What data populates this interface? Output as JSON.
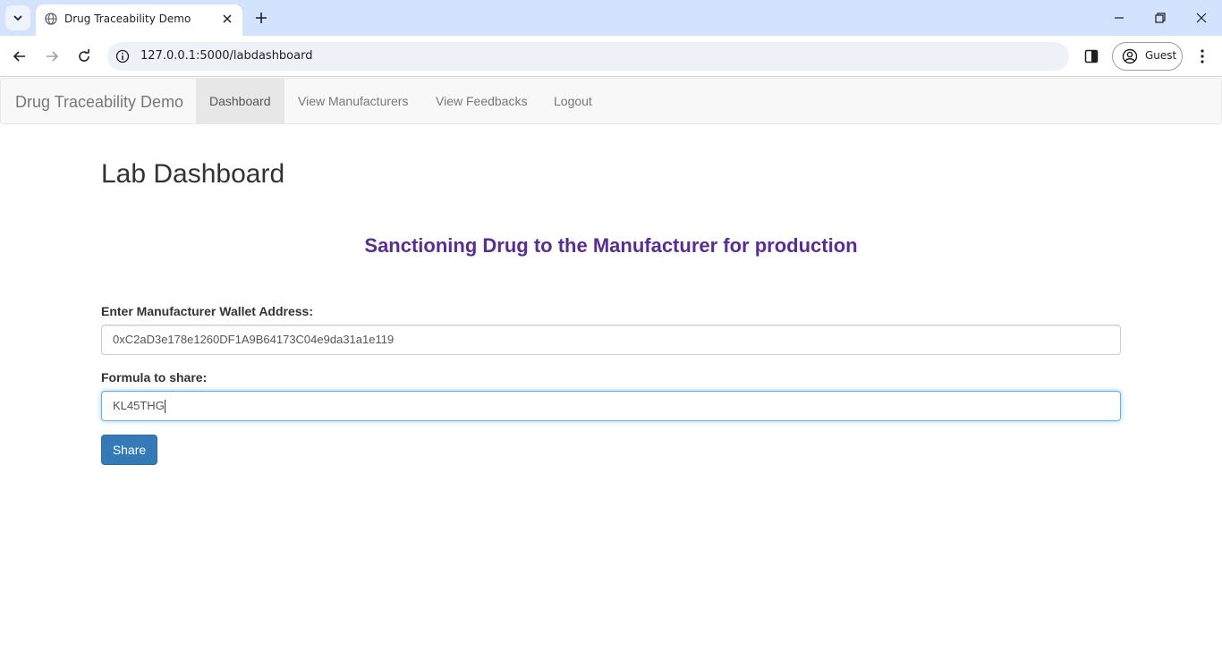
{
  "browser": {
    "tab_title": "Drug Traceability Demo",
    "url": "127.0.0.1:5000/labdashboard",
    "profile_label": "Guest"
  },
  "navbar": {
    "brand": "Drug Traceability Demo",
    "items": [
      {
        "label": "Dashboard",
        "active": true
      },
      {
        "label": "View Manufacturers",
        "active": false
      },
      {
        "label": "View Feedbacks",
        "active": false
      },
      {
        "label": "Logout",
        "active": false
      }
    ]
  },
  "main": {
    "title": "Lab Dashboard",
    "subtitle": "Sanctioning Drug to the Manufacturer for production",
    "wallet_label": "Enter Manufacturer Wallet Address:",
    "wallet_value": "0xC2aD3e178e1260DF1A9B64173C04e9da31a1e119",
    "formula_label": "Formula to share:",
    "formula_value": "KL45THG",
    "share_label": "Share"
  },
  "colors": {
    "tabstrip": "#d3e3fd",
    "subtitle": "#5a2d91",
    "primary_button": "#337ab7",
    "focus_border": "#66afe9"
  }
}
